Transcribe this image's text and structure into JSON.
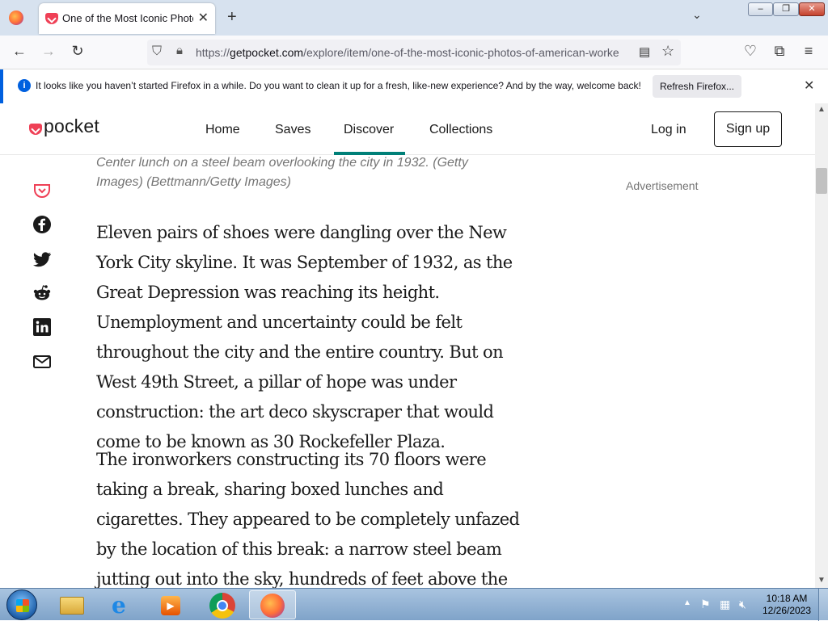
{
  "browser": {
    "tab_title": "One of the Most Iconic Photos",
    "url_host": "getpocket.com",
    "url_prefix": "https://",
    "url_path": "/explore/item/one-of-the-most-iconic-photos-of-american-worke",
    "notification": "It looks like you haven’t started Firefox in a while. Do you want to clean it up for a fresh, like-new experience? And by the way, welcome back!",
    "refresh_button": "Refresh Firefox..."
  },
  "header": {
    "logo": "pocket",
    "nav": [
      "Home",
      "Saves",
      "Discover",
      "Collections"
    ],
    "active_nav": "Discover",
    "login": "Log in",
    "signup": "Sign up",
    "accent_color": "#008078",
    "brand_color": "#ef4056"
  },
  "article": {
    "caption": "Center lunch on a steel beam overlooking the city in 1932. (Getty Images) (Bettmann/Getty Images)",
    "advertisement_label": "Advertisement",
    "paragraphs": [
      "Eleven pairs of shoes were dangling over the New York City skyline. It was September of 1932, as the Great Depression was reaching its height. Unemployment and uncertainty could be felt throughout the city and the entire country. But on West 49th Street, a pillar of hope was under construction: the art deco skyscraper that would come to be known as 30 Rockefeller Plaza.",
      "The ironworkers constructing its 70 floors were taking a break, sharing boxed lunches and cigarettes. They appeared to be completely unfazed by the location of this break: a narrow steel beam jutting out into the sky, hundreds of feet above the pavement."
    ],
    "share_icons": [
      "pocket-save-icon",
      "facebook-icon",
      "twitter-icon",
      "reddit-icon",
      "linkedin-icon",
      "email-icon"
    ]
  },
  "taskbar": {
    "time": "10:18 AM",
    "date": "12/26/2023",
    "apps": [
      "file-explorer-icon",
      "internet-explorer-icon",
      "media-player-icon",
      "chrome-icon",
      "firefox-icon"
    ]
  }
}
